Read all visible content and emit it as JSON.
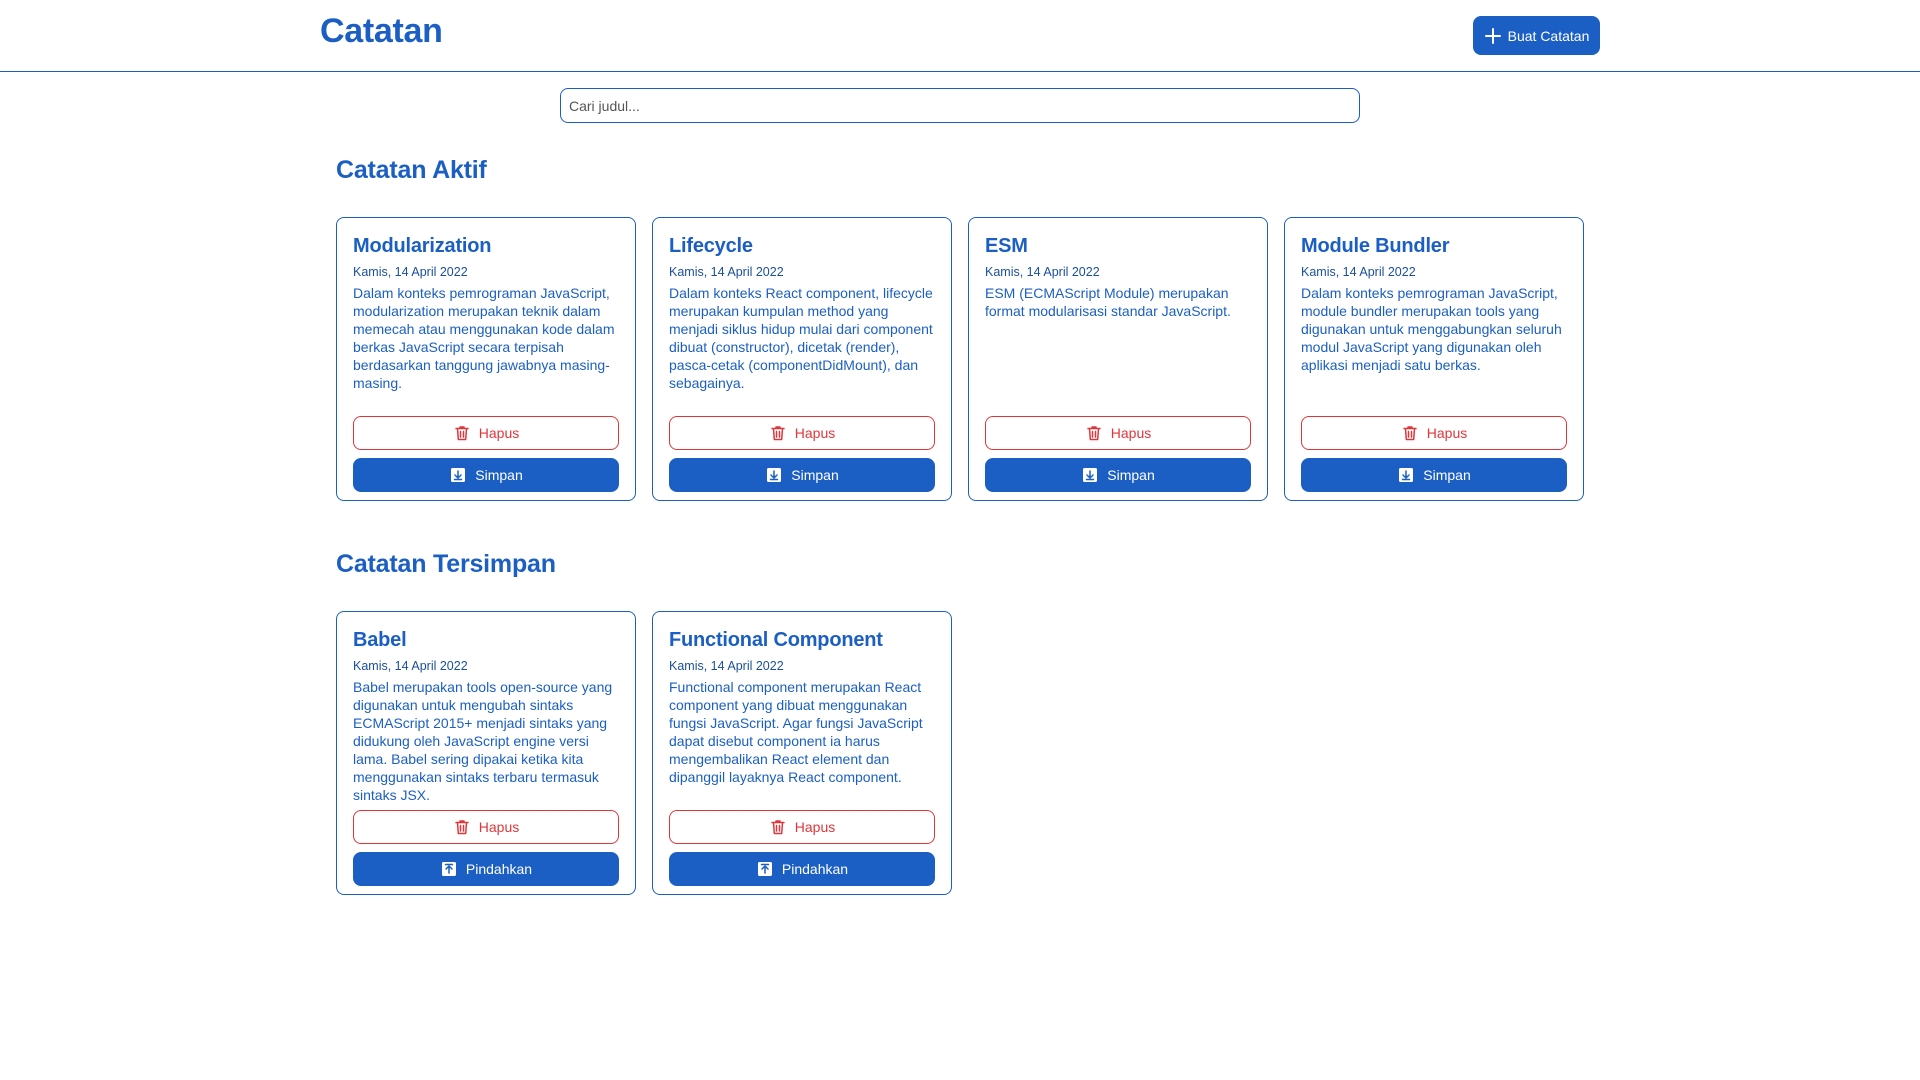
{
  "header": {
    "title": "Catatan",
    "create_button": {
      "label": "Buat Catatan",
      "icon": "plus-icon"
    }
  },
  "search": {
    "placeholder": "Cari judul..."
  },
  "colors": {
    "primary": "#1b5fc4",
    "danger": "#e0363a"
  },
  "active_section": {
    "title": "Catatan Aktif",
    "notes": [
      {
        "title": "Modularization",
        "date": "Kamis, 14 April 2022",
        "body": "Dalam konteks pemrograman JavaScript, modularization merupakan teknik dalam memecah atau menggunakan kode dalam berkas JavaScript secara terpisah berdasarkan tanggung jawabnya masing-masing.",
        "delete_label": "Hapus",
        "action_label": "Simpan"
      },
      {
        "title": "Lifecycle",
        "date": "Kamis, 14 April 2022",
        "body": "Dalam konteks React component, lifecycle merupakan kumpulan method yang menjadi siklus hidup mulai dari component dibuat (constructor), dicetak (render), pasca-cetak (componentDidMount), dan sebagainya.",
        "delete_label": "Hapus",
        "action_label": "Simpan"
      },
      {
        "title": "ESM",
        "date": "Kamis, 14 April 2022",
        "body": "ESM (ECMAScript Module) merupakan format modularisasi standar JavaScript.",
        "delete_label": "Hapus",
        "action_label": "Simpan"
      },
      {
        "title": "Module Bundler",
        "date": "Kamis, 14 April 2022",
        "body": "Dalam konteks pemrograman JavaScript, module bundler merupakan tools yang digunakan untuk menggabungkan seluruh modul JavaScript yang digunakan oleh aplikasi menjadi satu berkas.",
        "delete_label": "Hapus",
        "action_label": "Simpan"
      }
    ]
  },
  "archived_section": {
    "title": "Catatan Tersimpan",
    "notes": [
      {
        "title": "Babel",
        "date": "Kamis, 14 April 2022",
        "body": "Babel merupakan tools open-source yang digunakan untuk mengubah sintaks ECMAScript 2015+ menjadi sintaks yang didukung oleh JavaScript engine versi lama. Babel sering dipakai ketika kita menggunakan sintaks terbaru termasuk sintaks JSX.",
        "delete_label": "Hapus",
        "action_label": "Pindahkan"
      },
      {
        "title": "Functional Component",
        "date": "Kamis, 14 April 2022",
        "body": "Functional component merupakan React component yang dibuat menggunakan fungsi JavaScript. Agar fungsi JavaScript dapat disebut component ia harus mengembalikan React element dan dipanggil layaknya React component.",
        "delete_label": "Hapus",
        "action_label": "Pindahkan"
      }
    ]
  }
}
